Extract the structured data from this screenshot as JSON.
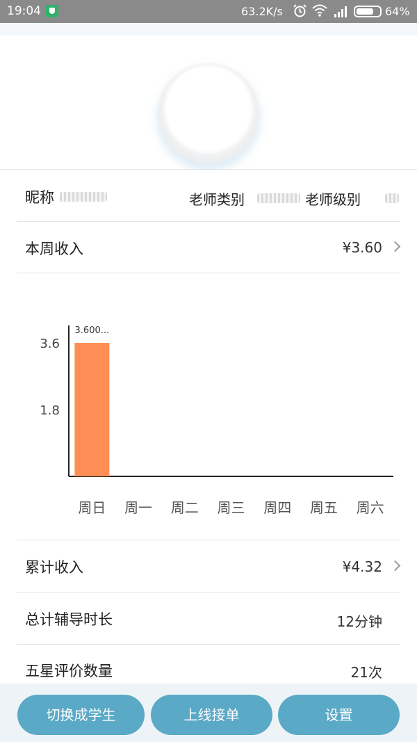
{
  "status_bar": {
    "time": "19:04",
    "network_speed": "63.2K/s",
    "battery_percent": "64%",
    "icons": [
      "shield-icon",
      "alarm-icon",
      "wifi-icon",
      "signal-icon",
      "battery-icon"
    ]
  },
  "profile": {
    "nickname_label": "昵称",
    "teacher_type_label": "老师类别",
    "teacher_level_label": "老师级别"
  },
  "weekly_income": {
    "label": "本周收入",
    "value": "¥3.60"
  },
  "chart_data": {
    "type": "bar",
    "categories": [
      "周日",
      "周一",
      "周二",
      "周三",
      "周四",
      "周五",
      "周六"
    ],
    "values": [
      3.6,
      0,
      0,
      0,
      0,
      0,
      0
    ],
    "y_ticks": [
      "1.8",
      "3.6"
    ],
    "data_labels": [
      "3.600...",
      "",
      "",
      "",
      "",
      "",
      ""
    ],
    "bar_color": "#ff8f57",
    "grid": false
  },
  "total_income": {
    "label": "累计收入",
    "value": "¥4.32"
  },
  "tutoring_time": {
    "label": "总计辅导时长",
    "value": "12分钟"
  },
  "five_star": {
    "label": "五星评价数量",
    "value": "21次"
  },
  "bottom_buttons": {
    "switch_student": "切换成学生",
    "go_online": "上线接单",
    "settings": "设置"
  },
  "colors": {
    "accent": "#5aa9c6",
    "status_bar": "#8a8a8a"
  }
}
